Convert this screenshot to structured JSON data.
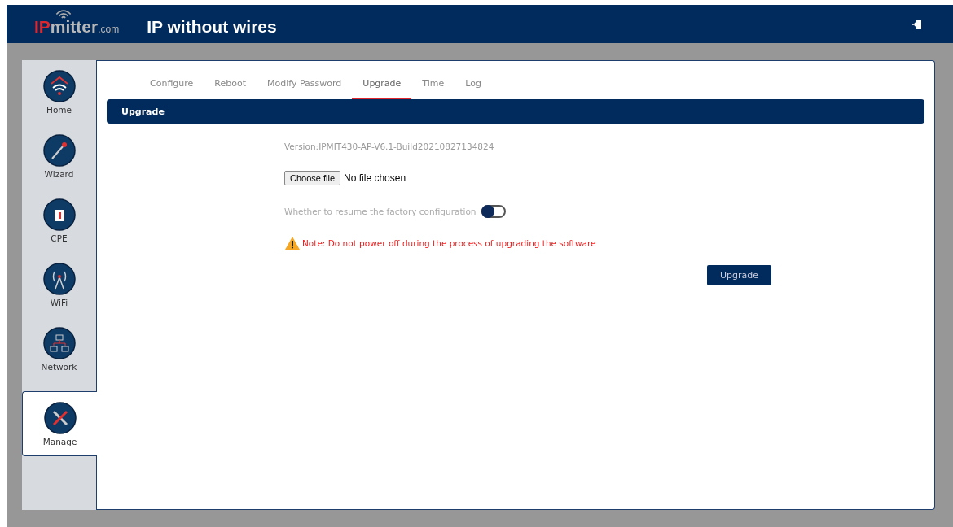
{
  "header": {
    "logo": {
      "prefix": "IP",
      "name": "mitter",
      "suffix": ".com"
    },
    "tagline": "IP without wires"
  },
  "sidebar": {
    "items": [
      {
        "label": "Home",
        "kind": "home",
        "selected": false
      },
      {
        "label": "Wizard",
        "kind": "wizard",
        "selected": false
      },
      {
        "label": "CPE",
        "kind": "cpe",
        "selected": false
      },
      {
        "label": "WiFi",
        "kind": "wifi",
        "selected": false
      },
      {
        "label": "Network",
        "kind": "network",
        "selected": false
      },
      {
        "label": "Manage",
        "kind": "manage",
        "selected": true
      }
    ]
  },
  "tabs": [
    {
      "label": "Configure",
      "selected": false
    },
    {
      "label": "Reboot",
      "selected": false
    },
    {
      "label": "Modify Password",
      "selected": false
    },
    {
      "label": "Upgrade",
      "selected": true
    },
    {
      "label": "Time",
      "selected": false
    },
    {
      "label": "Log",
      "selected": false
    }
  ],
  "section_title": "Upgrade",
  "version": "Version:IPMIT430-AP-V6.1-Build20210827134824",
  "file_input": {
    "button": "Choose file",
    "status": "No file chosen"
  },
  "factory_reset": {
    "label": "Whether to resume the factory configuration",
    "on": false
  },
  "note": "Note: Do not power off during the process of upgrading the software",
  "submit": "Upgrade"
}
